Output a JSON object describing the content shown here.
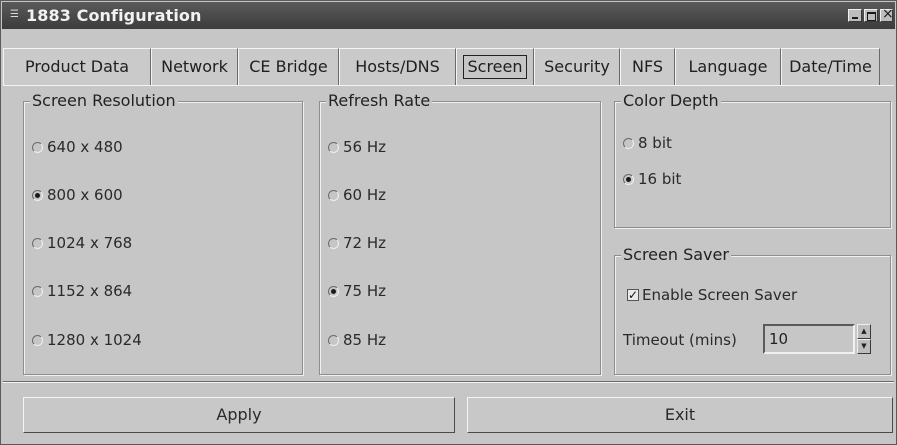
{
  "window": {
    "title": "1883 Configuration"
  },
  "tabs": [
    {
      "label": "Product Data"
    },
    {
      "label": "Network"
    },
    {
      "label": "CE Bridge"
    },
    {
      "label": "Hosts/DNS"
    },
    {
      "label": "Screen"
    },
    {
      "label": "Security"
    },
    {
      "label": "NFS"
    },
    {
      "label": "Language"
    },
    {
      "label": "Date/Time"
    }
  ],
  "active_tab": "Screen",
  "screen_resolution": {
    "title": "Screen Resolution",
    "options": [
      "640 x 480",
      "800 x 600",
      "1024 x 768",
      "1152 x 864",
      "1280 x 1024"
    ],
    "selected": "800 x 600"
  },
  "refresh_rate": {
    "title": "Refresh Rate",
    "options": [
      "56 Hz",
      "60 Hz",
      "72 Hz",
      "75 Hz",
      "85 Hz"
    ],
    "selected": "75 Hz"
  },
  "color_depth": {
    "title": "Color Depth",
    "options": [
      "8 bit",
      "16 bit"
    ],
    "selected": "16 bit"
  },
  "screen_saver": {
    "title": "Screen Saver",
    "enable_label": "Enable Screen Saver",
    "enabled": true,
    "timeout_label": "Timeout (mins)",
    "timeout_value": "10"
  },
  "buttons": {
    "apply": "Apply",
    "exit": "Exit"
  }
}
